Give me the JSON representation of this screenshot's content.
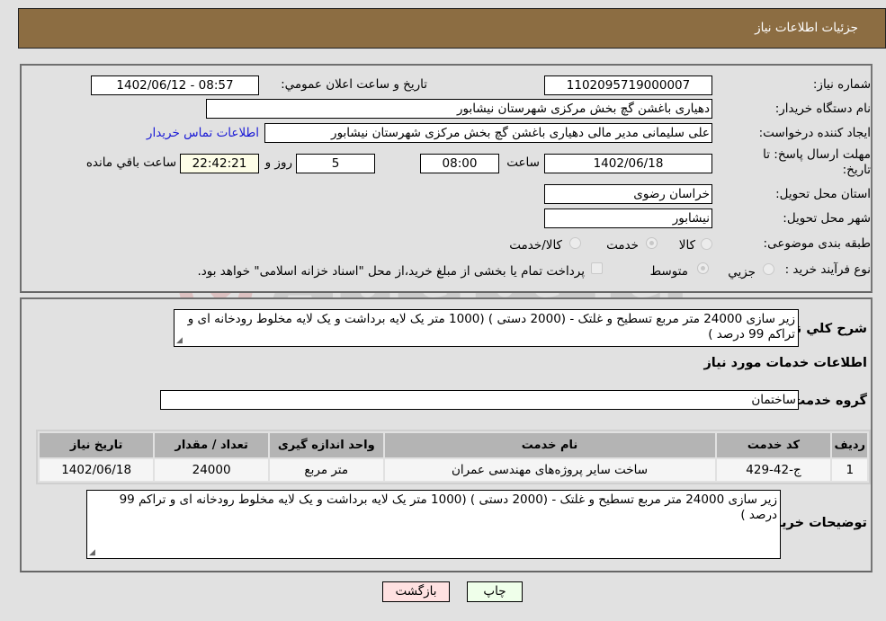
{
  "header": {
    "title": "جزئیات اطلاعات نیاز"
  },
  "form": {
    "need_number": {
      "label": "شماره نیاز:",
      "value": "1102095719000007"
    },
    "announce_datetime": {
      "label": "تاریخ و ساعت اعلان عمومي:",
      "value": "1402/06/12 - 08:57"
    },
    "buyer_org": {
      "label": "نام دستگاه خریدار:",
      "value": "دهیاری باغشن گچ بخش مرکزی شهرستان نیشابور"
    },
    "requester": {
      "label": "ایجاد کننده درخواست:",
      "value": "علی سلیمانی مدیر مالی دهیاری باغشن گچ بخش مرکزی شهرستان نیشابور"
    },
    "contact_link": "اطلاعات تماس خریدار",
    "deadline": {
      "label_line1": "مهلت ارسال پاسخ: تا",
      "label_line2": "تاریخ:",
      "date": "1402/06/18",
      "time_label": "ساعت",
      "time": "08:00",
      "days": "5",
      "days_label": "روز و",
      "remaining": "22:42:21",
      "remaining_label": "ساعت باقي مانده"
    },
    "province": {
      "label": "استان محل تحویل:",
      "value": "خراسان رضوی"
    },
    "city": {
      "label": "شهر محل تحویل:",
      "value": "نیشابور"
    },
    "category": {
      "label": "طبقه بندی موضوعی:",
      "options": [
        "کالا",
        "خدمت",
        "کالا/خدمت"
      ],
      "selected": "خدمت"
    },
    "purchase_type": {
      "label": "نوع فرآیند خرید :",
      "options": [
        "جزيي",
        "متوسط"
      ],
      "selected": "متوسط",
      "treasury_note": "پرداخت تمام یا بخشی از مبلغ خرید،از محل \"اسناد خزانه اسلامی\" خواهد بود.",
      "treasury_checked": false
    }
  },
  "description": {
    "label": "شرح کلي نیاز:",
    "value": "زیر سازی 24000 متر مربع تسطیح و غلتک - (2000 دستی ) (1000 متر یک لایه برداشت و یک لایه مخلوط رودخانه ای و تراکم 99 درصد )"
  },
  "services": {
    "section_title": "اطلاعات خدمات مورد نیاز",
    "group_label": "گروه خدمت:",
    "group_value": "ساختمان",
    "columns": [
      "ردیف",
      "کد خدمت",
      "نام خدمت",
      "واحد اندازه گیری",
      "تعداد / مقدار",
      "تاریخ نیاز"
    ],
    "rows": [
      [
        "1",
        "ج-42-429",
        "ساخت سایر پروژه‌های مهندسی عمران",
        "متر مربع",
        "24000",
        "1402/06/18"
      ]
    ]
  },
  "buyer_notes": {
    "label": "توضیحات خریدار:",
    "value": "زیر سازی 24000 متر مربع تسطیح و غلتک - (2000 دستی ) (1000 متر یک لایه برداشت و یک لایه مخلوط رودخانه ای و تراکم 99 درصد )"
  },
  "buttons": {
    "print": "چاپ",
    "back": "بازگشت"
  },
  "watermark": "AriaTender.neT",
  "colors": {
    "header": "#8c6d42",
    "print_bg": "#efffea",
    "back_bg": "#ffe1e1",
    "link": "#1a1ad6"
  }
}
